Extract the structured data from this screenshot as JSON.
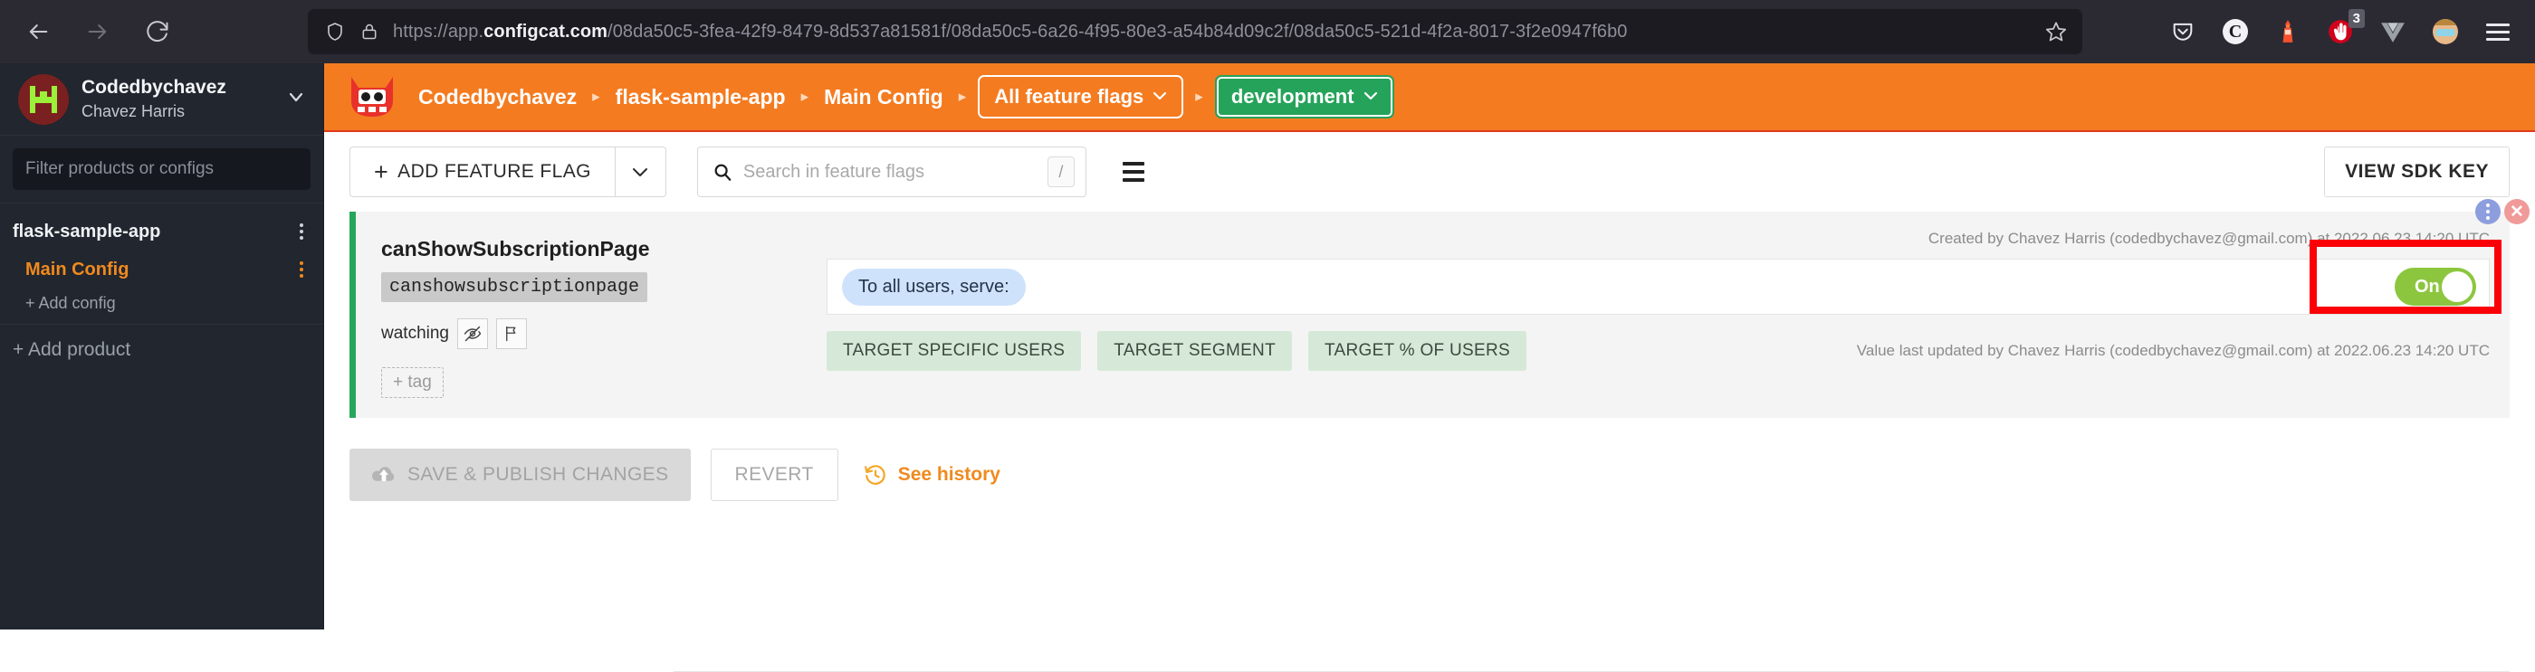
{
  "browser": {
    "back_icon": "arrow-left-icon",
    "forward_icon": "arrow-right-icon",
    "reload_icon": "reload-icon",
    "shield_icon": "shield-icon",
    "lock_icon": "lock-icon",
    "url_scheme": "https://app.",
    "url_host": "configcat.com",
    "url_path": "/08da50c5-3fea-42f9-8479-8d537a81581f/08da50c5-6a26-4f95-80e3-a54b84d09c2f/08da50c5-521d-4f2a-8017-3f2e0947f6b0",
    "bookmark_icon": "star-icon",
    "extensions": [
      {
        "name": "pocket-icon",
        "badge": ""
      },
      {
        "name": "circle-c-icon",
        "label": "C",
        "badge": ""
      },
      {
        "name": "lighthouse-icon",
        "badge": ""
      },
      {
        "name": "red-extension-icon",
        "badge": "3"
      },
      {
        "name": "vue-devtools-icon",
        "badge": ""
      },
      {
        "name": "profile-avatar-icon",
        "badge": ""
      },
      {
        "name": "hamburger-menu-icon",
        "badge": ""
      }
    ]
  },
  "sidebar": {
    "org_glyph": "H",
    "org_name": "Codedbychavez",
    "user_name": "Chavez Harris",
    "org_chevron": "chevron-down-icon",
    "filter_placeholder": "Filter products or configs",
    "filter_value": "",
    "product": "flask-sample-app",
    "config": "Main Config",
    "add_config": "+ Add config",
    "add_product": "+ Add product"
  },
  "topbar": {
    "logo": "configcat-cat-logo",
    "breadcrumbs": [
      {
        "label": "Codedbychavez",
        "type": "text"
      },
      {
        "label": "flask-sample-app",
        "type": "text"
      },
      {
        "label": "Main Config",
        "type": "text"
      },
      {
        "label": "All feature flags",
        "type": "dropdown"
      },
      {
        "label": "development",
        "type": "env-dropdown"
      }
    ],
    "separator": "▸",
    "caret": "⌄",
    "bg_color": "#f47b20",
    "env_color": "#25a35a"
  },
  "toolbar": {
    "add_flag_label": "ADD FEATURE FLAG",
    "add_flag_plus": "+",
    "add_flag_caret": "chevron-down-icon",
    "search_placeholder": "Search in feature flags",
    "search_value": "",
    "search_shortcut": "/",
    "list_view_icon": "list-view-icon",
    "view_sdk_key_label": "VIEW SDK KEY"
  },
  "flag": {
    "name": "canShowSubscriptionPage",
    "key": "canshowsubscriptionpage",
    "watching_label": "watching",
    "watch_icons": [
      "eye-off-icon",
      "flag-icon"
    ],
    "add_tag_label": "+ tag",
    "created_info": "Created by Chavez Harris (codedbychavez@gmail.com) at 2022.06.23 14:20 UTC",
    "updated_info": "Value last updated by Chavez Harris (codedbychavez@gmail.com) at 2022.06.23 14:20 UTC",
    "serve_label": "To all users, serve:",
    "toggle_state": "On",
    "toggle_on": true,
    "toggle_color": "#8cc63e",
    "highlight_color": "#fb0007",
    "accent_bar_color": "#26a65b",
    "targeting_buttons": [
      "TARGET SPECIFIC USERS",
      "TARGET SEGMENT",
      "TARGET % OF USERS"
    ],
    "corner_icons": [
      "info-dots-icon",
      "close-icon"
    ]
  },
  "actions": {
    "save_label": "SAVE & PUBLISH CHANGES",
    "save_icon": "cloud-upload-icon",
    "revert_label": "REVERT",
    "history_label": "See history",
    "history_icon": "history-clock-icon"
  }
}
